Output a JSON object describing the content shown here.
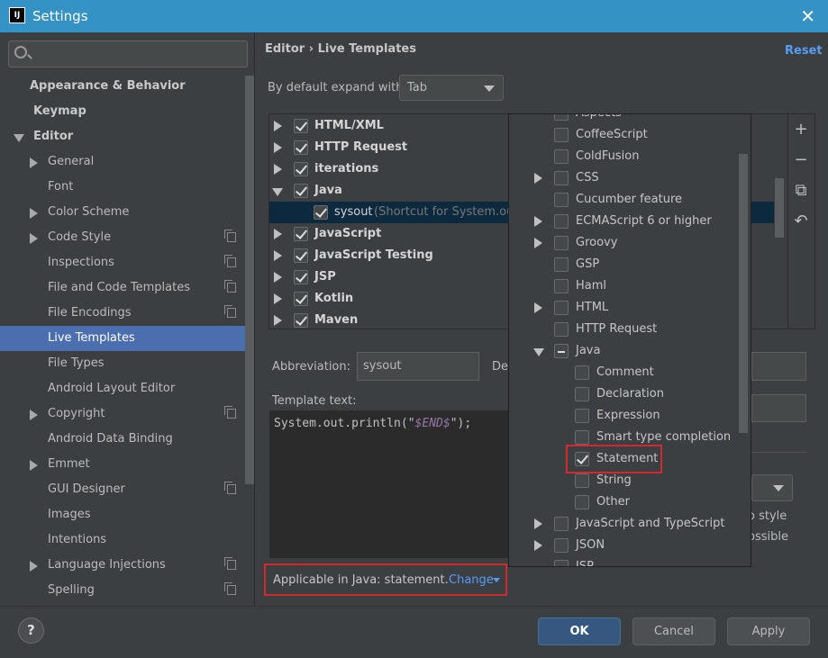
{
  "window": {
    "title": "Settings",
    "app_icon": "IJ",
    "close_icon": "✕"
  },
  "search": {
    "placeholder": ""
  },
  "sidebar": {
    "items": [
      {
        "label": "Appearance & Behavior",
        "bold": true
      },
      {
        "label": "Keymap",
        "bold": true
      },
      {
        "label": "Editor",
        "bold": true,
        "expanded": true
      },
      {
        "label": "General",
        "arrow": true
      },
      {
        "label": "Font"
      },
      {
        "label": "Color Scheme",
        "arrow": true
      },
      {
        "label": "Code Style",
        "arrow": true,
        "copy": true
      },
      {
        "label": "Inspections",
        "copy": true
      },
      {
        "label": "File and Code Templates",
        "copy": true
      },
      {
        "label": "File Encodings",
        "copy": true
      },
      {
        "label": "Live Templates",
        "selected": true
      },
      {
        "label": "File Types"
      },
      {
        "label": "Android Layout Editor"
      },
      {
        "label": "Copyright",
        "arrow": true,
        "copy": true
      },
      {
        "label": "Android Data Binding"
      },
      {
        "label": "Emmet",
        "arrow": true
      },
      {
        "label": "GUI Designer",
        "copy": true
      },
      {
        "label": "Images"
      },
      {
        "label": "Intentions"
      },
      {
        "label": "Language Injections",
        "arrow": true,
        "copy": true
      },
      {
        "label": "Spelling",
        "copy": true
      }
    ]
  },
  "main": {
    "breadcrumb": "Editor  ›  Live Templates",
    "reset": "Reset",
    "expand_label": "By default expand with",
    "expand_value": "Tab",
    "tree": [
      {
        "label": "HTML/XML",
        "checked": true
      },
      {
        "label": "HTTP Request",
        "checked": true
      },
      {
        "label": "iterations",
        "checked": true
      },
      {
        "label": "Java",
        "checked": true,
        "expanded": true
      },
      {
        "label": "sysout",
        "desc": "(Shortcut for System.out",
        "checked": true,
        "child": true,
        "selected": true
      },
      {
        "label": "JavaScript",
        "checked": true
      },
      {
        "label": "JavaScript Testing",
        "checked": true
      },
      {
        "label": "JSP",
        "checked": true
      },
      {
        "label": "Kotlin",
        "checked": true
      },
      {
        "label": "Maven",
        "checked": true
      }
    ],
    "tools": [
      "+",
      "−",
      "⧉",
      "↶"
    ],
    "abbreviation_label": "Abbreviation:",
    "abbreviation_value": "sysout",
    "description_label": "De",
    "template_text_label": "Template text:",
    "template_code_prefix": "System.out.println(\"",
    "template_code_var": "$END$",
    "template_code_suffix": "\");",
    "options_style": "o style",
    "options_possible": "ossible",
    "applicable_text": "Applicable in Java: statement.",
    "change_link": "Change"
  },
  "popup": {
    "rows": [
      {
        "label": "Aspects",
        "level": 0
      },
      {
        "label": "CoffeeScript",
        "level": 0
      },
      {
        "label": "ColdFusion",
        "level": 0
      },
      {
        "label": "CSS",
        "level": 0,
        "arrow": true
      },
      {
        "label": "Cucumber feature",
        "level": 0
      },
      {
        "label": "ECMAScript 6 or higher",
        "level": 0,
        "arrow": true
      },
      {
        "label": "Groovy",
        "level": 0,
        "arrow": true
      },
      {
        "label": "GSP",
        "level": 0
      },
      {
        "label": "Haml",
        "level": 0
      },
      {
        "label": "HTML",
        "level": 0,
        "arrow": true
      },
      {
        "label": "HTTP Request",
        "level": 0
      },
      {
        "label": "Java",
        "level": 0,
        "expanded": true,
        "mixed": true
      },
      {
        "label": "Comment",
        "level": 1
      },
      {
        "label": "Declaration",
        "level": 1
      },
      {
        "label": "Expression",
        "level": 1
      },
      {
        "label": "Smart type completion",
        "level": 1
      },
      {
        "label": "Statement",
        "level": 1,
        "checked": true
      },
      {
        "label": "String",
        "level": 1
      },
      {
        "label": "Other",
        "level": 1
      },
      {
        "label": "JavaScript and TypeScript",
        "level": 0,
        "arrow": true
      },
      {
        "label": "JSON",
        "level": 0,
        "arrow": true
      },
      {
        "label": "JSP",
        "level": 0
      }
    ]
  },
  "buttons": {
    "help": "?",
    "ok": "OK",
    "cancel": "Cancel",
    "apply": "Apply"
  }
}
